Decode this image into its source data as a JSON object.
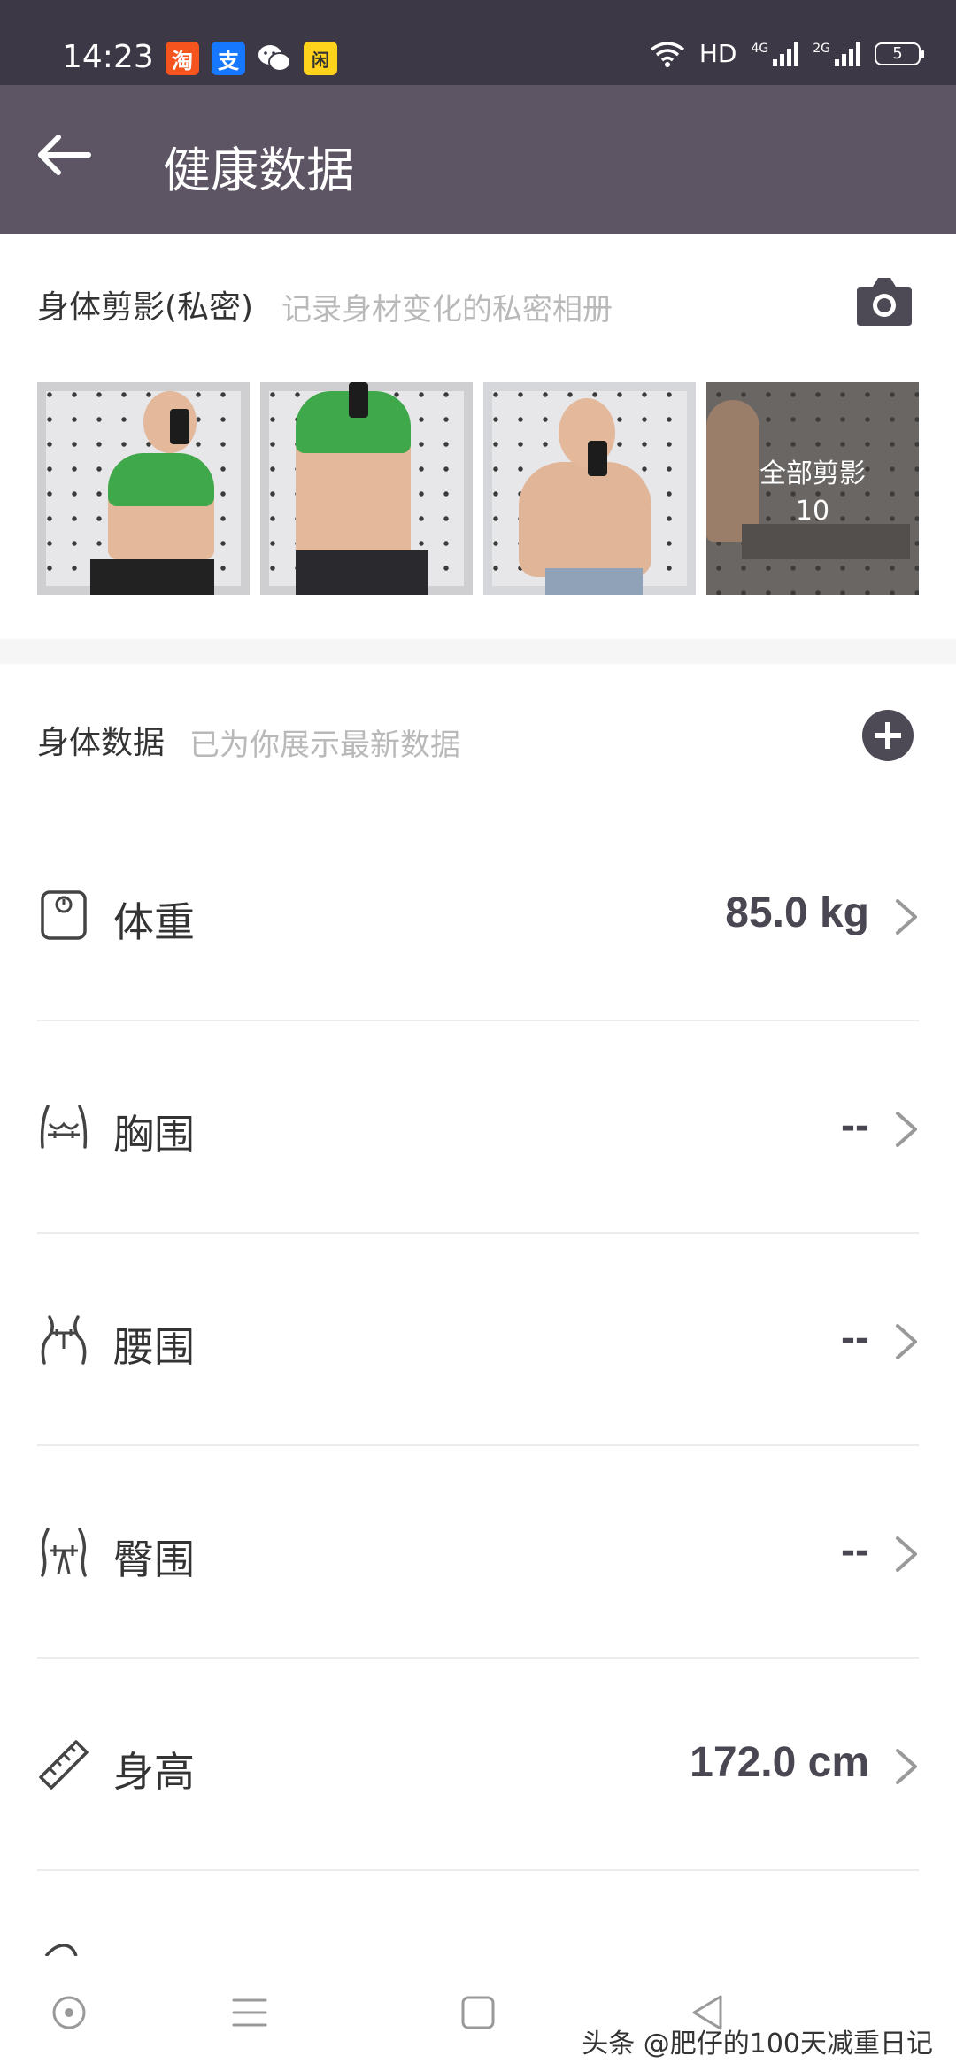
{
  "status_bar": {
    "time": "14:23",
    "app_icons": [
      {
        "name": "taobao-icon",
        "glyph": "淘",
        "bg": "#f5541e",
        "fg": "#ffffff"
      },
      {
        "name": "alipay-icon",
        "glyph": "支",
        "bg": "#1677ff",
        "fg": "#ffffff"
      },
      {
        "name": "wechat-icon",
        "glyph": "✉",
        "bg": "#3c3845",
        "fg": "#ffffff"
      },
      {
        "name": "app-icon-yellow",
        "glyph": "闲",
        "bg": "#ffd21c",
        "fg": "#333333"
      }
    ],
    "hd_label": "HD",
    "net1_label": "4G",
    "net2_label": "2G",
    "battery": "5"
  },
  "header": {
    "title": "健康数据"
  },
  "silhouette": {
    "title": "身体剪影(私密)",
    "subtitle": "记录身材变化的私密相册",
    "all_label": "全部剪影",
    "all_count": "10"
  },
  "body_data": {
    "title": "身体数据",
    "subtitle": "已为你展示最新数据",
    "rows": [
      {
        "label": "体重",
        "value": "85.0 kg",
        "icon": "scale-icon"
      },
      {
        "label": "胸围",
        "value": "--",
        "icon": "chest-icon"
      },
      {
        "label": "腰围",
        "value": "--",
        "icon": "waist-icon"
      },
      {
        "label": "臀围",
        "value": "--",
        "icon": "hip-icon"
      },
      {
        "label": "身高",
        "value": "172.0 cm",
        "icon": "ruler-icon"
      }
    ]
  },
  "watermark": "头条 @肥仔的100天减重日记",
  "colors": {
    "header_bg": "#5d5464",
    "status_bg": "#3c3845",
    "accent": "#4e4a55"
  }
}
